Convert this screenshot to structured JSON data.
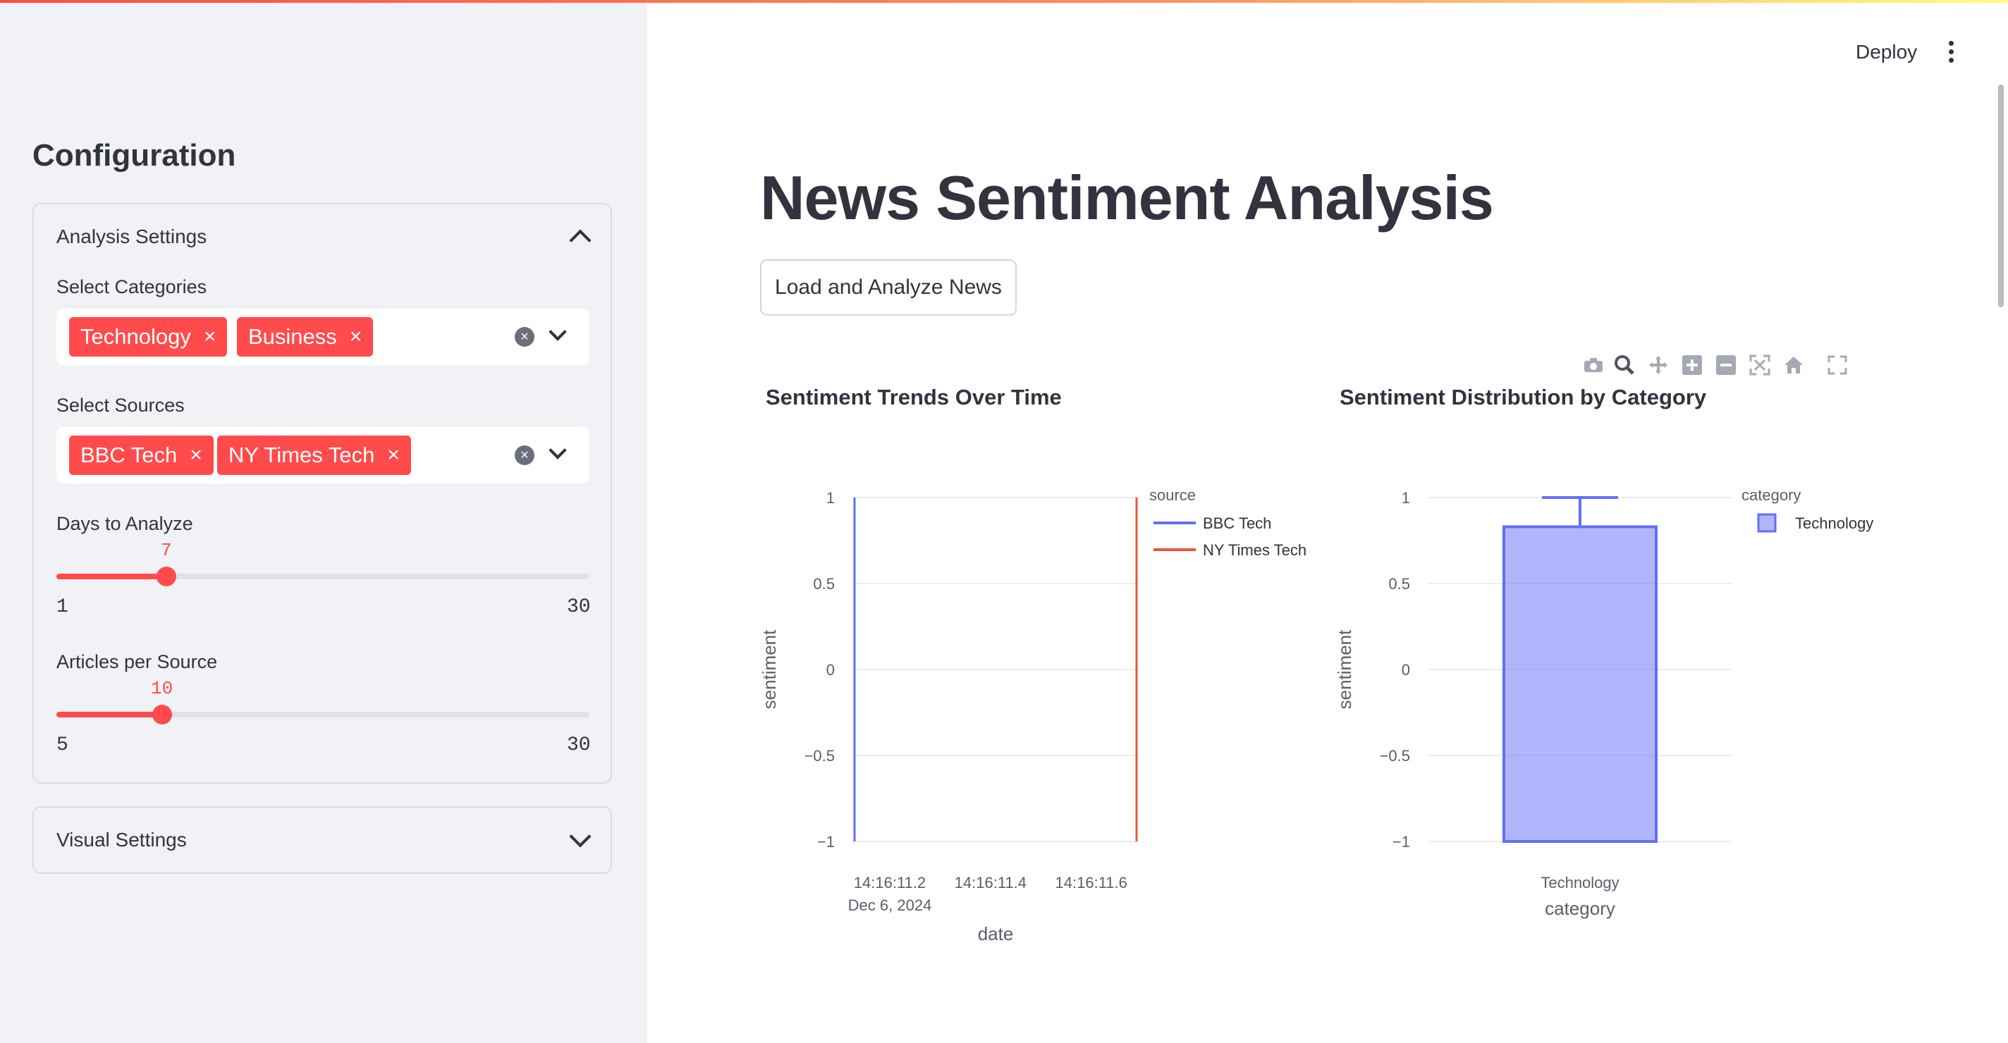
{
  "header": {
    "deploy_label": "Deploy"
  },
  "sidebar": {
    "title": "Configuration",
    "analysis_settings": {
      "label": "Analysis Settings",
      "categories": {
        "label": "Select Categories",
        "tags": [
          "Technology",
          "Business"
        ]
      },
      "sources": {
        "label": "Select Sources",
        "tags": [
          "BBC Tech",
          "NY Times Tech"
        ]
      },
      "days": {
        "label": "Days to Analyze",
        "value": "7",
        "min": "1",
        "max": "30"
      },
      "articles": {
        "label": "Articles per Source",
        "value": "10",
        "min": "5",
        "max": "30"
      }
    },
    "visual_settings": {
      "label": "Visual Settings"
    }
  },
  "main": {
    "title": "News Sentiment Analysis",
    "load_button": "Load and Analyze News",
    "modebar_icons": [
      "camera-icon",
      "zoom-icon",
      "pan-icon",
      "zoom-in-icon",
      "zoom-out-icon",
      "autoscale-icon",
      "reset-axes-icon",
      "fullscreen-icon"
    ]
  },
  "chart_data": [
    {
      "type": "line",
      "title": "Sentiment Trends Over Time",
      "xlabel": "date",
      "ylabel": "sentiment",
      "x_ticks": [
        "14:16:11.2",
        "14:16:11.4",
        "14:16:11.6"
      ],
      "x_tick_sub": "Dec 6, 2024",
      "y_ticks": [
        "1",
        "0.5",
        "0",
        "−0.5",
        "−1"
      ],
      "ylim": [
        -1,
        1
      ],
      "legend_title": "source",
      "legend_position": "right",
      "series": [
        {
          "name": "BBC Tech",
          "color": "#636efa",
          "x": [
            "2024-12-06 14:16:11.130",
            "2024-12-06 14:16:11.130"
          ],
          "y": [
            -1,
            1
          ]
        },
        {
          "name": "NY Times Tech",
          "color": "#ef553b",
          "x": [
            "2024-12-06 14:16:11.690",
            "2024-12-06 14:16:11.690"
          ],
          "y": [
            -1,
            1
          ]
        }
      ]
    },
    {
      "type": "box",
      "title": "Sentiment Distribution by Category",
      "xlabel": "category",
      "ylabel": "sentiment",
      "categories": [
        "Technology"
      ],
      "y_ticks": [
        "1",
        "0.5",
        "0",
        "−0.5",
        "−1"
      ],
      "ylim": [
        -1,
        1
      ],
      "legend_title": "category",
      "legend_position": "right",
      "series": [
        {
          "name": "Technology",
          "color": "#636efa",
          "min": -1,
          "q1": -1,
          "median": -1,
          "q3": 0.83,
          "max": 1
        }
      ]
    }
  ]
}
